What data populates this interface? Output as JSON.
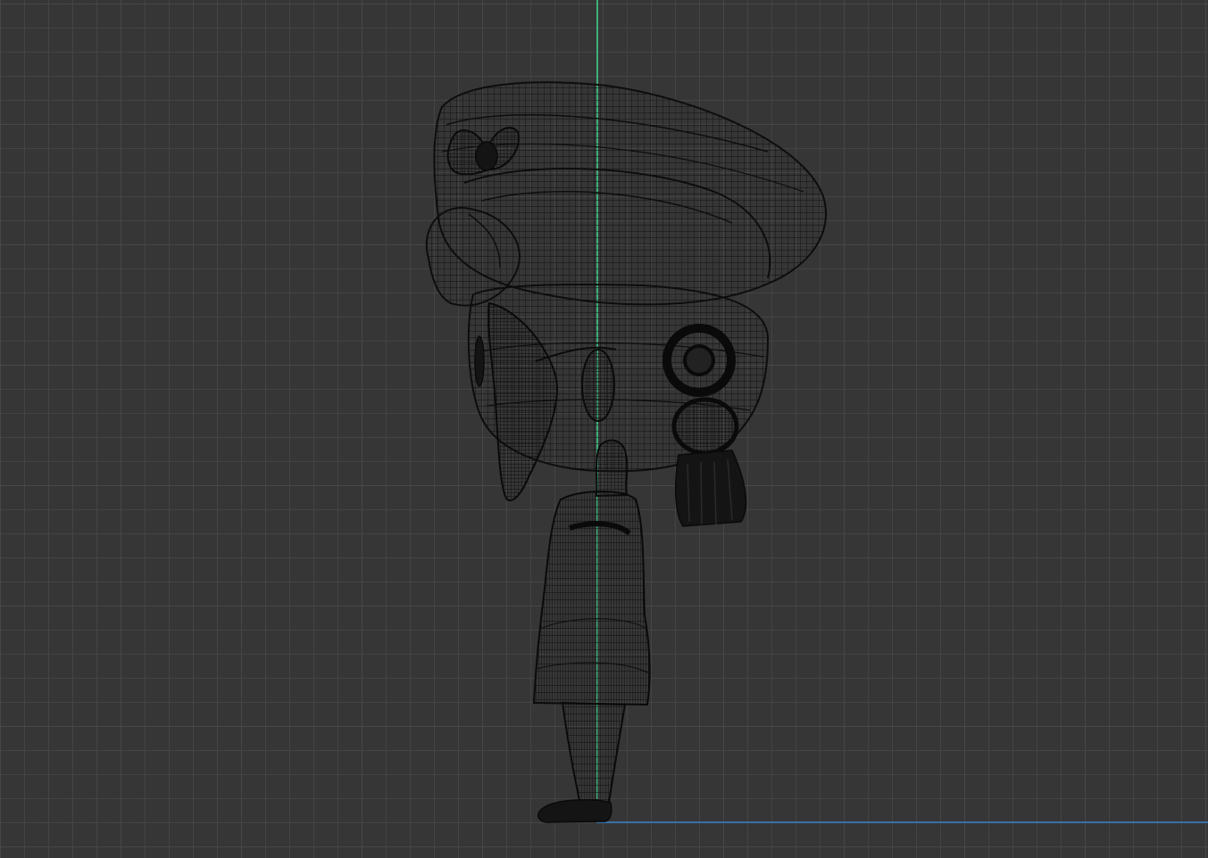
{
  "viewport": {
    "label": "",
    "colors": {
      "background": "#363636",
      "grid_minor": "#464646",
      "grid_major": "#555555",
      "axis_vertical": "#3fae7c",
      "axis_horizontal": "#3b6fa8",
      "wireframe": "#111111"
    }
  },
  "model": {
    "display_mode": "wireframe",
    "icon": "character-mesh-icon"
  }
}
